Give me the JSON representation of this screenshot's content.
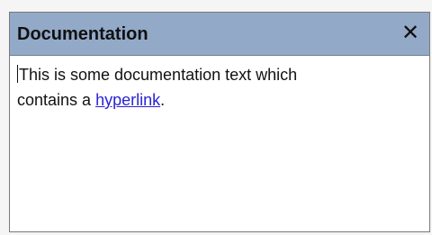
{
  "panel": {
    "title": "Documentation",
    "close_label": "✕",
    "content": {
      "text_line1": "This is some documentation text which",
      "text_line2_before_link": "contains a ",
      "link_text": "hyperlink",
      "text_line2_after_link": "."
    }
  },
  "colors": {
    "titlebar_bg": "#93a9c8",
    "link": "#2b22d6"
  }
}
